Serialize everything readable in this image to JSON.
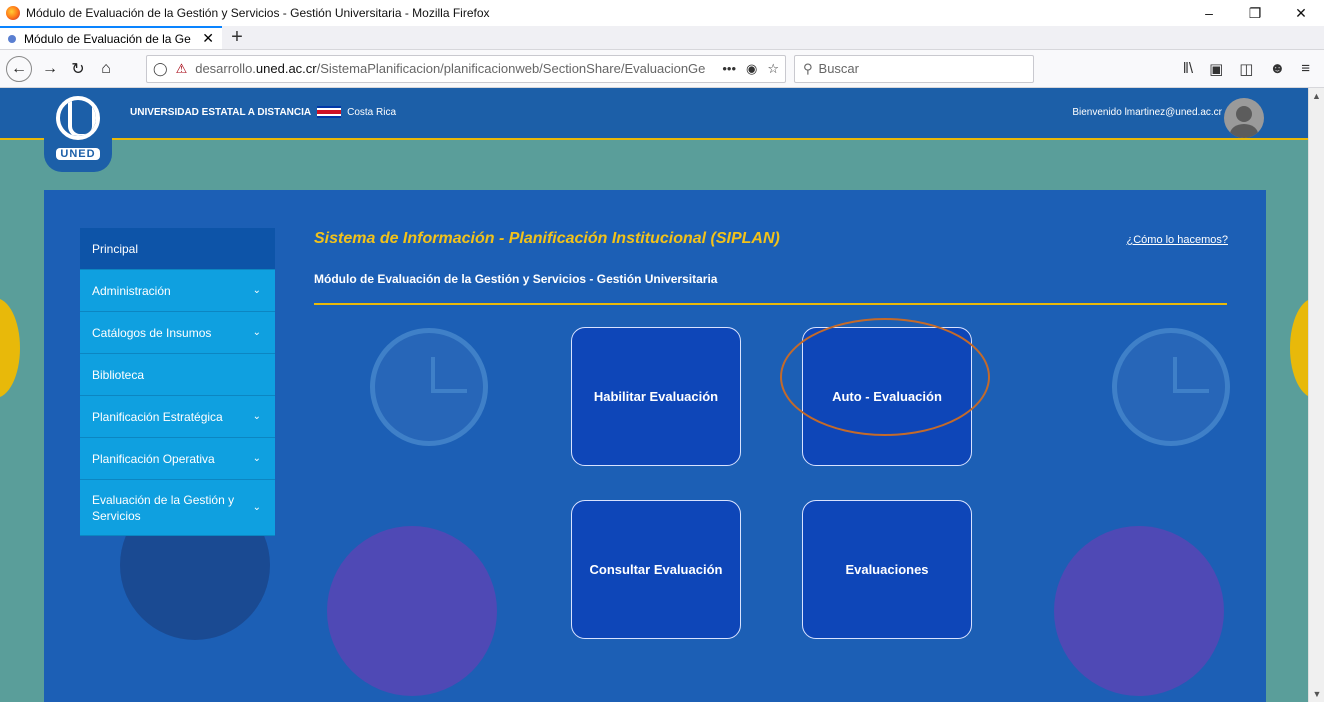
{
  "browser": {
    "window_title": "Módulo de Evaluación de la Gestión y Servicios - Gestión Universitaria - Mozilla Firefox",
    "tab_title": "Módulo de Evaluación de la Ge",
    "url_prefix": "desarrollo.",
    "url_domain": "uned.ac.cr",
    "url_path": "/SistemaPlanificacion/planificacionweb/SectionShare/EvaluacionGe",
    "search_placeholder": "Buscar"
  },
  "header": {
    "university": "UNIVERSIDAD ESTATAL A DISTANCIA",
    "country": "Costa Rica",
    "logo_text": "UNED",
    "welcome": "Bienvenido lmartinez@uned.ac.cr"
  },
  "sidebar": {
    "items": [
      {
        "label": "Principal"
      },
      {
        "label": "Administración"
      },
      {
        "label": "Catálogos de Insumos"
      },
      {
        "label": "Biblioteca"
      },
      {
        "label": "Planificación Estratégica"
      },
      {
        "label": "Planificación Operativa"
      },
      {
        "label": "Evaluación de la Gestión y Servicios"
      }
    ]
  },
  "main": {
    "title": "Sistema de Información - Planificación Institucional (SIPLAN)",
    "help_link": "¿Cómo lo hacemos?",
    "subtitle": "Módulo de Evaluación de la Gestión y Servicios - Gestión Universitaria",
    "tiles": [
      {
        "label": "Habilitar Evaluación"
      },
      {
        "label": "Auto - Evaluación"
      },
      {
        "label": "Consultar Evaluación"
      },
      {
        "label": "Evaluaciones"
      }
    ]
  },
  "colors": {
    "header_bg": "#1c5fa8",
    "accent_gold": "#e8b90a",
    "sidebar_bg": "#0fa0e0",
    "sidebar_active": "#0d54a8",
    "tile_bg": "#0e46b8",
    "highlight_ring": "#c46a2a"
  }
}
